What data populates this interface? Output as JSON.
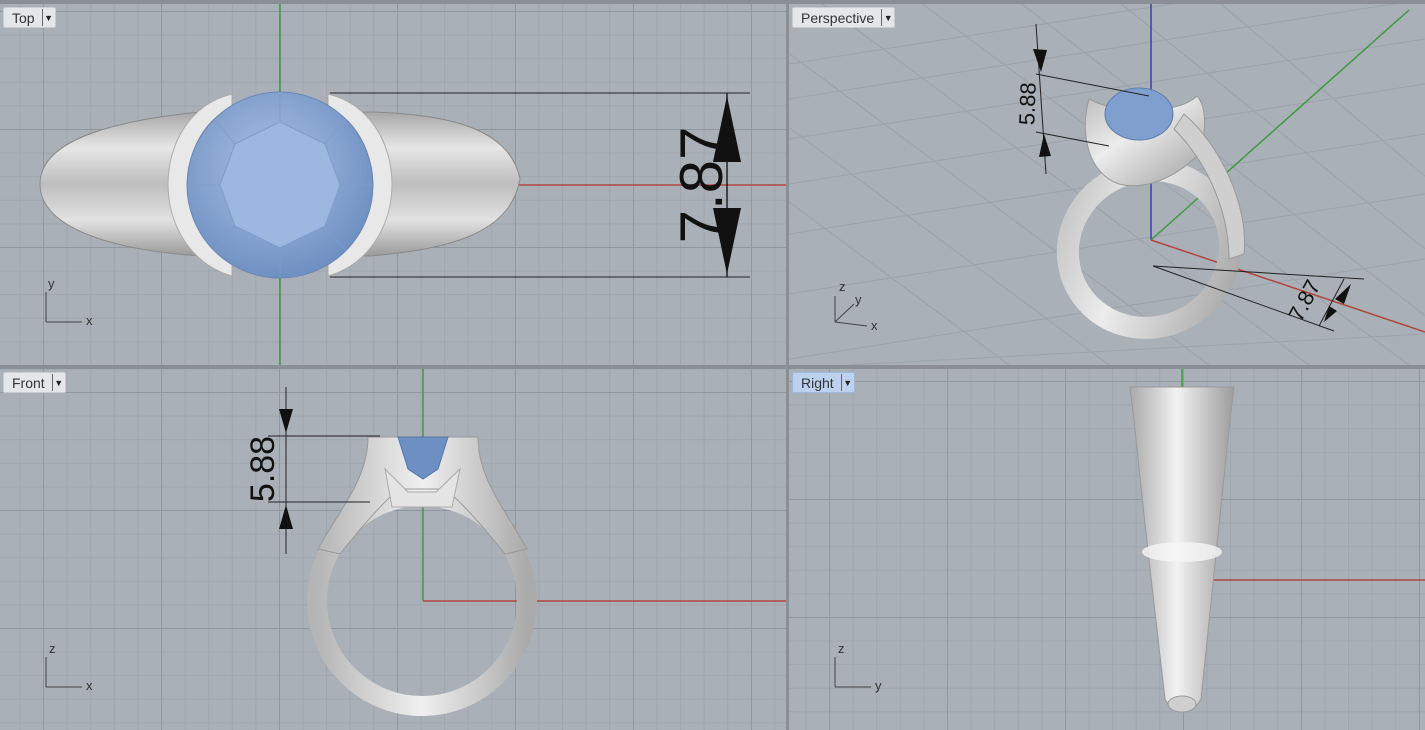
{
  "viewports": {
    "top": {
      "label": "Top",
      "axis_h": "x",
      "axis_v": "y",
      "dim_width": "7.87"
    },
    "persp": {
      "label": "Perspective",
      "axis_z": "z",
      "axis_y": "y",
      "axis_x": "x",
      "dim_height": "5.88",
      "dim_width": "7.87"
    },
    "front": {
      "label": "Front",
      "axis_h": "x",
      "axis_v": "z",
      "dim_height": "5.88"
    },
    "right": {
      "label": "Right",
      "axis_h": "y",
      "axis_v": "z"
    }
  },
  "active_viewport": "Right",
  "dropdown_icon": "triangle-down-icon",
  "colors": {
    "grid_bg": "#a9b0b8",
    "x_axis": "#b2473f",
    "y_axis": "#3f9a3f",
    "z_axis": "#3a3fb0",
    "gem": "#7f9fcf",
    "metal": "#d9d9d9",
    "active_label": "#bcd2ee"
  }
}
